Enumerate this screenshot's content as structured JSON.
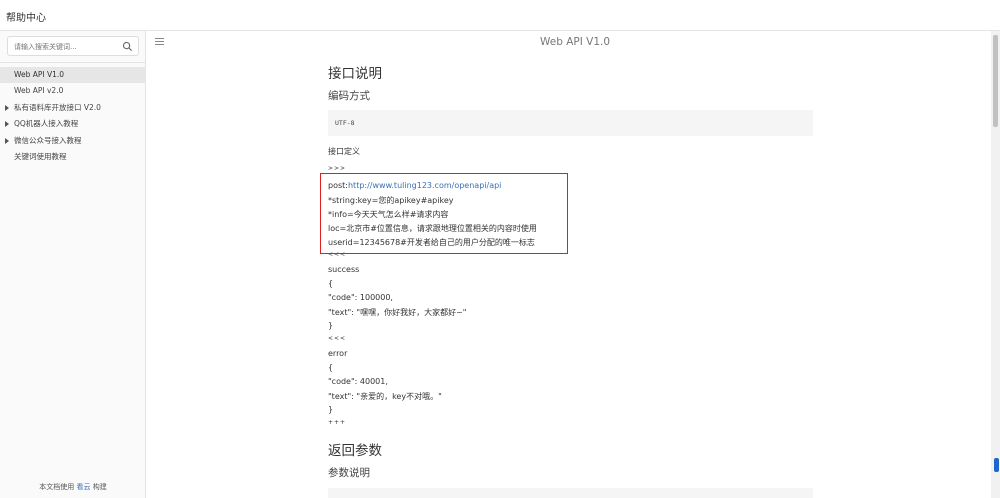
{
  "header": {
    "title": "帮助中心"
  },
  "sidebar": {
    "search_placeholder": "请输入搜索关键词...",
    "items": [
      {
        "label": "Web API V1.0",
        "active": true,
        "expandable": false
      },
      {
        "label": "Web API v2.0",
        "active": false,
        "expandable": false
      },
      {
        "label": "私有语料库开放接口 V2.0",
        "active": false,
        "expandable": true
      },
      {
        "label": "QQ机器人接入教程",
        "active": false,
        "expandable": true
      },
      {
        "label": "微信公众号接入教程",
        "active": false,
        "expandable": true
      },
      {
        "label": "关键词使用教程",
        "active": false,
        "expandable": false
      }
    ],
    "footer": {
      "prefix": "本文档使用 ",
      "link": "看云",
      "suffix": " 构建"
    }
  },
  "page": {
    "title": "Web API V1.0"
  },
  "doc": {
    "h_interface": "接口说明",
    "h_encoding": "编码方式",
    "encoding_value": "UTF-8",
    "interface_def": "接口定义",
    "arrows_open": ">>>",
    "post_label": "post:",
    "post_url": "http://www.tuling123.com/openapi/api",
    "param_key": "*string:key=您的apikey#apikey",
    "param_info": "*info=今天天气怎么样#请求内容",
    "param_loc": "loc=北京市#位置信息，请求跟地理位置相关的内容时使用",
    "param_userid": "userid=12345678#开发者给自己的用户分配的唯一标志",
    "arrows_close1": "<<<",
    "success_label": "success",
    "brace_open1": "{",
    "success_code": "\"code\": 100000,",
    "success_text": "\"text\": \"嘿嘿，你好我好，大家都好~\"",
    "brace_close1": "}",
    "arrows_close2": "<<<",
    "error_label": "error",
    "brace_open2": "{",
    "error_code": "\"code\": 40001,",
    "error_text": "\"text\": \"亲爱的，key不对哦。\"",
    "brace_close2": "}",
    "plus_line": "+++",
    "h_return": "返回参数",
    "h_param_desc": "参数说明"
  },
  "colors": {
    "link": "#3b6fb6",
    "highlight": "#e0201c",
    "scroll_marker": "#1e66c9"
  }
}
